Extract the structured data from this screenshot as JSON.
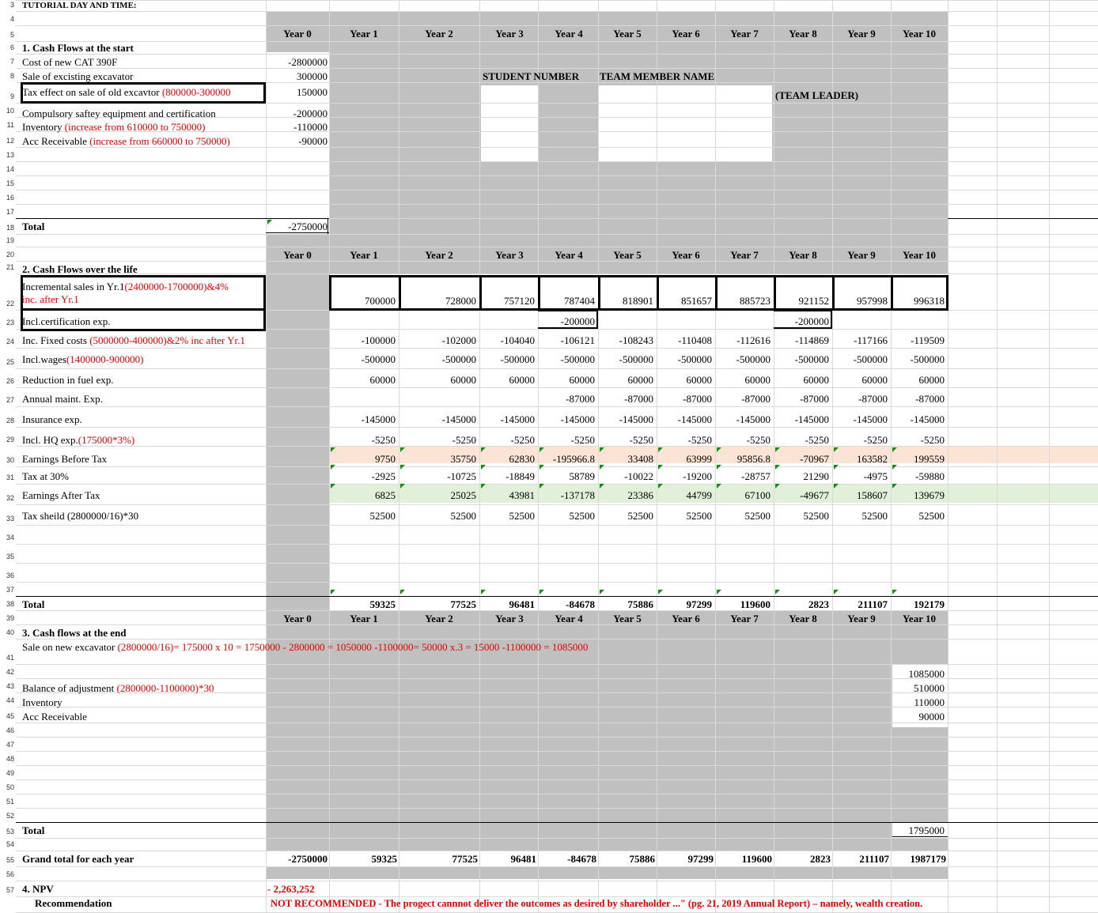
{
  "rows": [
    "3",
    "4",
    "5",
    "6",
    "7",
    "8",
    "9",
    "10",
    "11",
    "12",
    "13",
    "14",
    "15",
    "16",
    "17",
    "18",
    "19",
    "20",
    "21",
    "22",
    "23",
    "24",
    "25",
    "26",
    "27",
    "28",
    "29",
    "30",
    "31",
    "32",
    "33",
    "34",
    "35",
    "36",
    "37",
    "38",
    "39",
    "40",
    "41",
    "42",
    "43",
    "44",
    "45",
    "46",
    "47",
    "48",
    "49",
    "50",
    "51",
    "52",
    "53",
    "54",
    "55",
    "56",
    "57"
  ],
  "header": {
    "tutorial": "TUTORIAL DAY AND TIME:"
  },
  "years": [
    "Year 0",
    "Year 1",
    "Year 2",
    "Year 3",
    "Year 4",
    "Year 5",
    "Year 6",
    "Year 7",
    "Year 8",
    "Year 9",
    "Year 10"
  ],
  "team": {
    "student_number": "STUDENT NUMBER",
    "member_name": "TEAM MEMBER NAME",
    "leader": "(TEAM LEADER)"
  },
  "s1": {
    "title": "1. Cash Flows at the start",
    "cost_label": "Cost of new CAT 390F",
    "cost_val": "-2800000",
    "sale_label": "Sale of excisting excavator",
    "sale_val": "300000",
    "tax_label": "Tax effect on sale of old excavtor ",
    "tax_red": "(800000-300000",
    "tax_val": "150000",
    "safety_label": "Compulsory saftey equipment and certification",
    "safety_val": "-200000",
    "inv_label": "Inventory ",
    "inv_red": "(increase from 610000 to 750000)",
    "inv_val": "-110000",
    "ar_label": "Acc Receivable ",
    "ar_red": "(increase from 660000 to 750000)",
    "ar_val": "-90000",
    "total_label": "Total",
    "total_val": "-2750000"
  },
  "s2": {
    "title": "2. Cash Flows over the life",
    "sales_label1": "Incremental sales in Yr.1",
    "sales_red1": "(2400000-1700000)&4%",
    "sales_red2": "inc. after Yr.1",
    "sales": [
      "700000",
      "728000",
      "757120",
      "787404",
      "818901",
      "851657",
      "885723",
      "921152",
      "957998",
      "996318"
    ],
    "cert_label": "Incl.certification exp.",
    "cert": [
      "",
      "",
      "",
      "-200000",
      "",
      "",
      "",
      "-200000",
      "",
      ""
    ],
    "fixed_label": "Inc. Fixed costs ",
    "fixed_red": "(5000000-400000)&2% inc after Yr.1",
    "fixed": [
      "-100000",
      "-102000",
      "-104040",
      "-106121",
      "-108243",
      "-110408",
      "-112616",
      "-114869",
      "-117166",
      "-119509"
    ],
    "wages_label": "Incl.wages",
    "wages_red": "(1400000-900000)",
    "wages": [
      "-500000",
      "-500000",
      "-500000",
      "-500000",
      "-500000",
      "-500000",
      "-500000",
      "-500000",
      "-500000",
      "-500000"
    ],
    "fuel_label": "Reduction in fuel exp.",
    "fuel": [
      "60000",
      "60000",
      "60000",
      "60000",
      "60000",
      "60000",
      "60000",
      "60000",
      "60000",
      "60000"
    ],
    "maint_label": "Annual maint. Exp.",
    "maint": [
      "",
      "",
      "",
      "-87000",
      "-87000",
      "-87000",
      "-87000",
      "-87000",
      "-87000",
      "-87000"
    ],
    "ins_label": "Insurance exp.",
    "ins": [
      "-145000",
      "-145000",
      "-145000",
      "-145000",
      "-145000",
      "-145000",
      "-145000",
      "-145000",
      "-145000",
      "-145000"
    ],
    "hq_label": "Incl. HQ exp.",
    "hq_red": "(175000*3%)",
    "hq": [
      "-5250",
      "-5250",
      "-5250",
      "-5250",
      "-5250",
      "-5250",
      "-5250",
      "-5250",
      "-5250",
      "-5250"
    ],
    "ebt_label": "Earnings Before Tax",
    "ebt": [
      "9750",
      "35750",
      "62830",
      "-195966.8",
      "33408",
      "63999",
      "95856.8",
      "-70967",
      "163582",
      "199559"
    ],
    "tax_label": "Tax at 30%",
    "tax": [
      "-2925",
      "-10725",
      "-18849",
      "58789",
      "-10022",
      "-19200",
      "-28757",
      "21290",
      "-4975",
      "-59880"
    ],
    "eat_label": "Earnings After Tax",
    "eat": [
      "6825",
      "25025",
      "43981",
      "-137178",
      "23386",
      "44799",
      "67100",
      "-49677",
      "158607",
      "139679"
    ],
    "shield_label": "Tax sheild (2800000/16)*30",
    "shield": [
      "52500",
      "52500",
      "52500",
      "52500",
      "52500",
      "52500",
      "52500",
      "52500",
      "52500",
      "52500"
    ],
    "total_label": "Total",
    "total": [
      "59325",
      "77525",
      "96481",
      "-84678",
      "75886",
      "97299",
      "119600",
      "2823",
      "211107",
      "192179"
    ]
  },
  "s3": {
    "title": "3. Cash flows at the end",
    "sale_label": "Sale on new excavator ",
    "sale_red": "(2800000/16)= 175000 x 10 = 1750000 - 2800000 = 1050000 -1100000= 50000 x.3 = 15000 -1100000 = 1085000",
    "sale_val": "1085000",
    "bal_label": "Balance of adjustment ",
    "bal_red": "(2800000-1100000)*30",
    "bal_val": "510000",
    "inv_label": "Inventory",
    "inv_val": "110000",
    "ar_label": "Acc Receivable",
    "ar_val": "90000",
    "total_label": "Total",
    "total_val": "1795000"
  },
  "grand": {
    "label": "Grand total for each year",
    "values": [
      "-2750000",
      "59325",
      "77525",
      "96481",
      "-84678",
      "75886",
      "97299",
      "119600",
      "2823",
      "211107",
      "1987179"
    ]
  },
  "npv": {
    "label": "4. NPV",
    "value": "- 2,263,252",
    "rec_label": "Recommendation",
    "rec_text": "NOT RECOMMENDED - The progect cannnot deliver the outcomes as desired by shareholder ...\" (pg. 21, 2019 Annual Report) – namely, wealth creation."
  }
}
